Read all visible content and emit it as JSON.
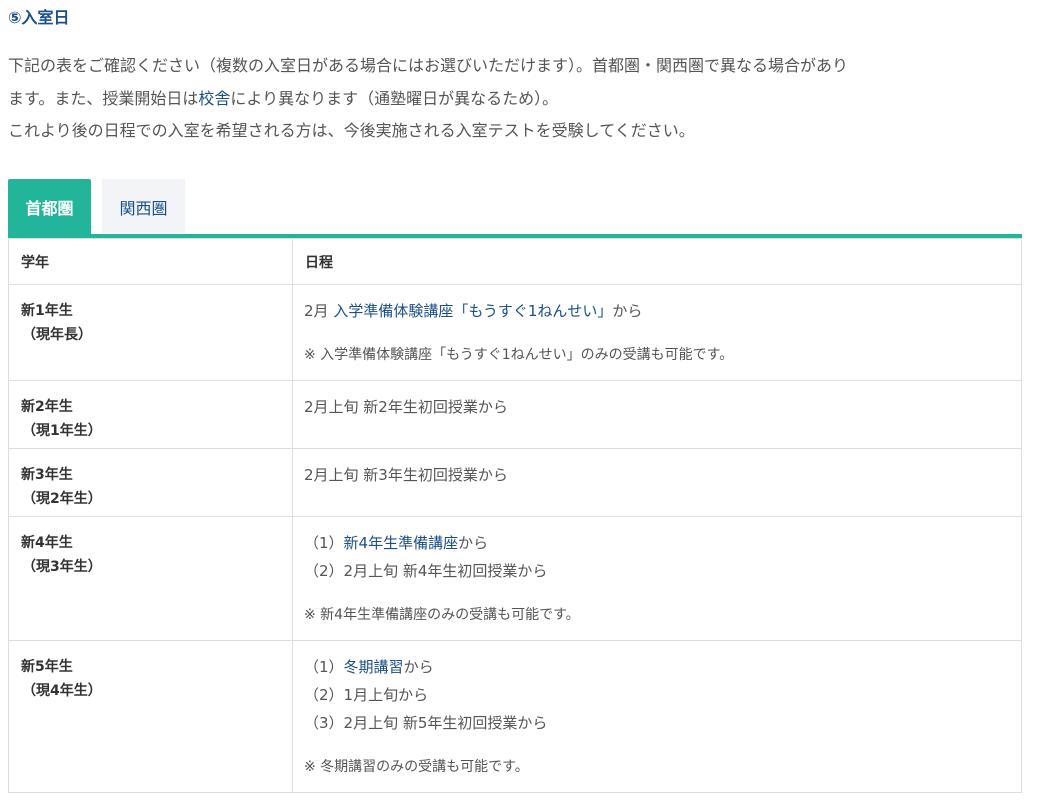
{
  "section_title": "⑤入室日",
  "intro": {
    "line1": "下記の表をご確認ください（複数の入室日がある場合にはお選びいただけます）。首都圏・関西圏で異なる場合があり",
    "line2_before": "ます。また、授業開始日は",
    "line2_link": "校舎",
    "line2_after": "により異なります（通塾曜日が異なるため）。",
    "line3": "これより後の日程での入室を希望される方は、今後実施される入室テストを受験してください。"
  },
  "tabs": {
    "active": "首都圏",
    "inactive": "関西圏"
  },
  "table": {
    "headers": {
      "grade": "学年",
      "schedule": "日程"
    },
    "rows": [
      {
        "grade": "新1年生",
        "current": "（現年長）",
        "line1_prefix": "2月 ",
        "line1_link": "入学準備体験講座「もうすぐ1ねんせい」",
        "line1_suffix": "から",
        "note": "※ 入学準備体験講座「もうすぐ1ねんせい」のみの受講も可能です。"
      },
      {
        "grade": "新2年生",
        "current": "（現1年生）",
        "line1": "2月上旬 新2年生初回授業から"
      },
      {
        "grade": "新3年生",
        "current": "（現2年生）",
        "line1": "2月上旬 新3年生初回授業から"
      },
      {
        "grade": "新4年生",
        "current": "（現3年生）",
        "line1_prefix": "（1）",
        "line1_link": "新4年生準備講座",
        "line1_suffix": "から",
        "line2": "（2）2月上旬 新4年生初回授業から",
        "note": "※ 新4年生準備講座のみの受講も可能です。"
      },
      {
        "grade": "新5年生",
        "current": "（現4年生）",
        "line1_prefix": "（1）",
        "line1_link": "冬期講習",
        "line1_suffix": "から",
        "line2": "（2）1月上旬から",
        "line3": "（3）2月上旬 新5年生初回授業から",
        "note": "※ 冬期講習のみの受講も可能です。"
      }
    ]
  }
}
